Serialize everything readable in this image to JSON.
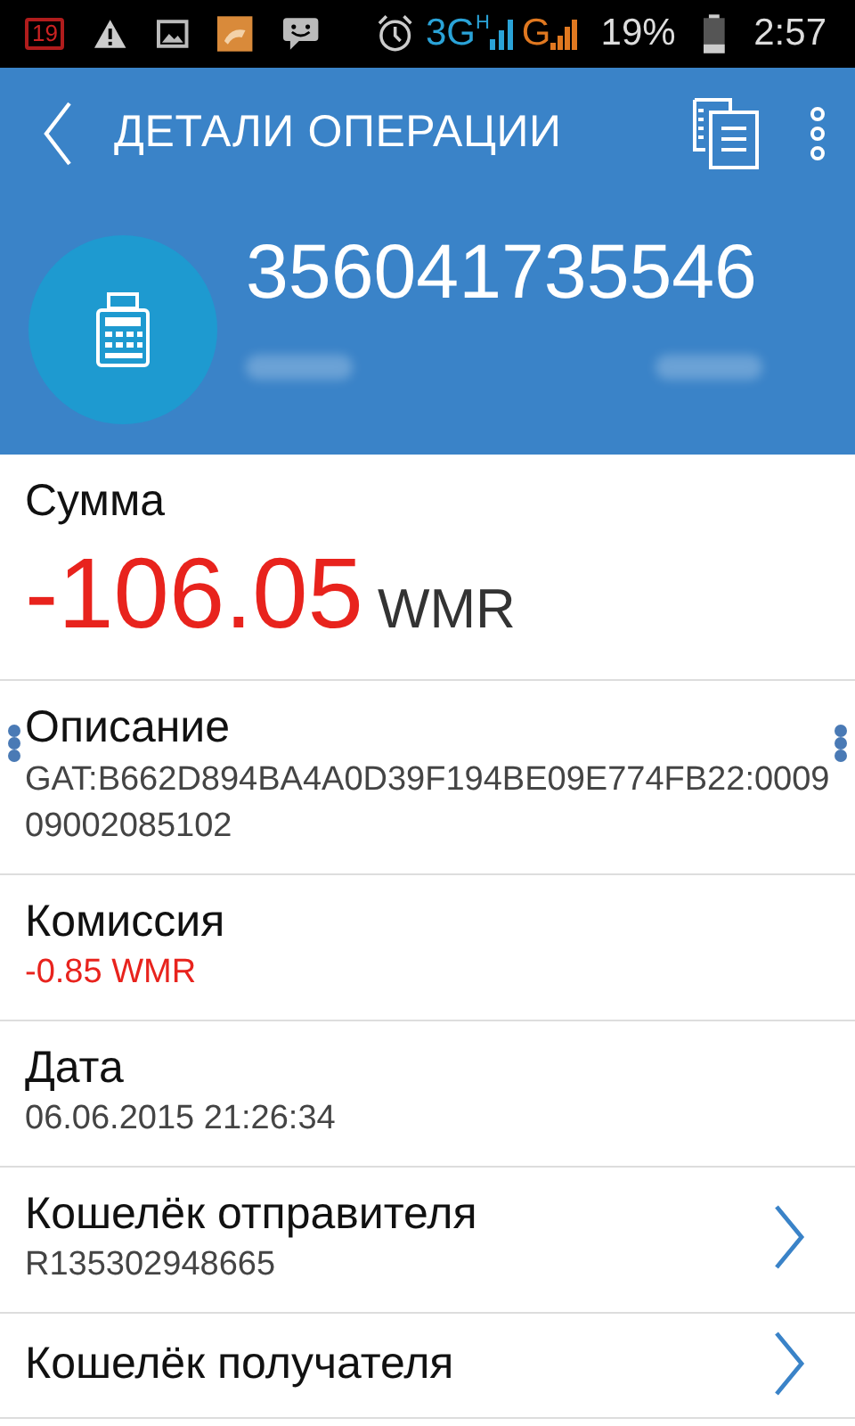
{
  "status_bar": {
    "calendar_badge": "19",
    "network_1": "3G",
    "network_1_sup": "H",
    "network_2": "G",
    "battery": "19%",
    "time": "2:57"
  },
  "toolbar": {
    "title": "ДЕТАЛИ ОПЕРАЦИИ"
  },
  "header": {
    "number": "356041735546"
  },
  "fields": [
    {
      "kind": "amount",
      "label": "Сумма",
      "value": "-106.05",
      "unit": "WMR"
    },
    {
      "kind": "text",
      "label": "Описание",
      "value": "GAT:B662D894BA4A0D39F194BE09E774FB22:000909002085102",
      "selection_handles": true
    },
    {
      "kind": "negative",
      "label": "Комиссия",
      "value": "-0.85 WMR"
    },
    {
      "kind": "text",
      "label": "Дата",
      "value": "06.06.2015 21:26:34"
    },
    {
      "kind": "link",
      "label": "Кошелёк отправителя",
      "value": "R135302948665"
    },
    {
      "kind": "link",
      "label": "Кошелёк получателя"
    }
  ]
}
